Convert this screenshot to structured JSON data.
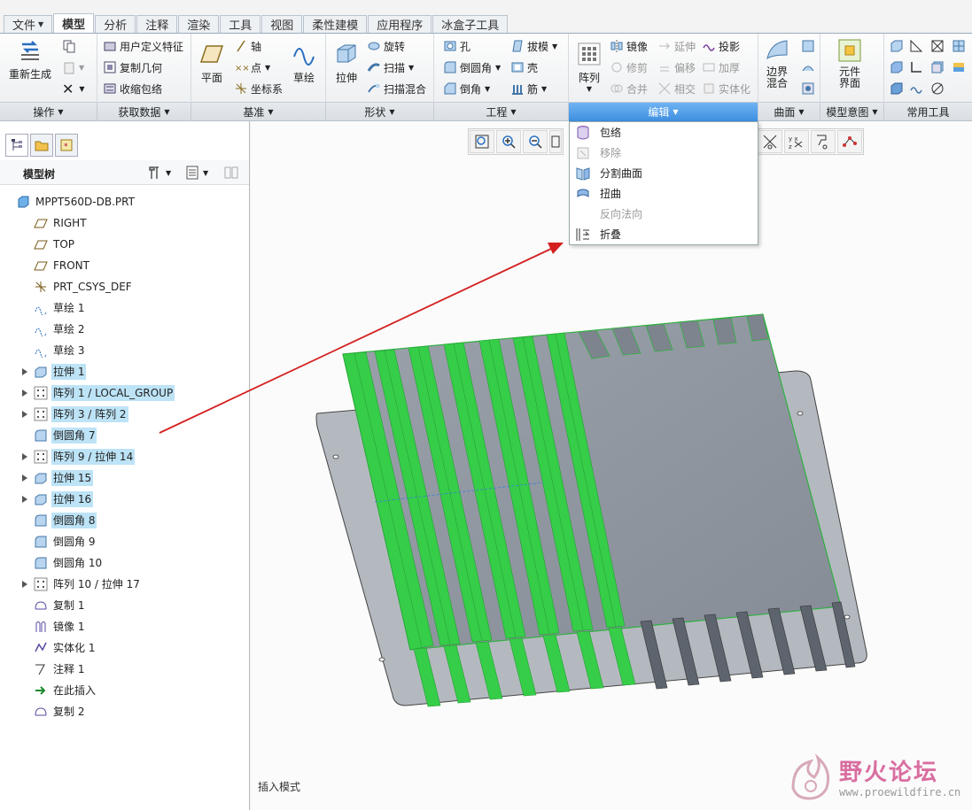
{
  "menubar": {
    "tabs": [
      "文件",
      "模型",
      "分析",
      "注释",
      "渲染",
      "工具",
      "视图",
      "柔性建模",
      "应用程序",
      "冰盒子工具"
    ],
    "active": "模型"
  },
  "ribbon": {
    "regenerate": "重新生成",
    "udf": "用户定义特征",
    "copy_geom": "复制几何",
    "shrinkwrap": "收缩包络",
    "plane": "平面",
    "axis": "轴",
    "point": "点",
    "csys": "坐标系",
    "sketch": "草绘",
    "extrude": "拉伸",
    "revolve": "旋转",
    "sweep": "扫描",
    "swept_blend": "扫描混合",
    "hole": "孔",
    "round": "倒圆角",
    "chamfer": "倒角",
    "draft": "拔模",
    "shell": "壳",
    "rib": "筋",
    "pattern": "阵列",
    "mirror": "镜像",
    "extend": "延伸",
    "project": "投影",
    "trim": "修剪",
    "offset": "偏移",
    "thicken": "加厚",
    "merge": "合并",
    "intersect": "相交",
    "solidify": "实体化",
    "boundary_blend_1": "边界",
    "boundary_blend_2": "混合",
    "component_interface_1": "元件",
    "component_interface_2": "界面"
  },
  "groups": {
    "operations": "操作",
    "get_data": "获取数据",
    "datum": "基准",
    "shapes": "形状",
    "engineering": "工程",
    "editing": "编辑",
    "surfaces": "曲面",
    "model_intent": "模型意图",
    "common_tools": "常用工具"
  },
  "edit_menu": {
    "items": [
      {
        "label": "包络",
        "enabled": true
      },
      {
        "label": "移除",
        "enabled": false
      },
      {
        "label": "分割曲面",
        "enabled": true
      },
      {
        "label": "扭曲",
        "enabled": true
      },
      {
        "label": "反向法向",
        "enabled": false
      },
      {
        "label": "折叠",
        "enabled": true
      }
    ]
  },
  "model_tree": {
    "title": "模型树",
    "items": [
      {
        "label": "MPPT560D-DB.PRT",
        "icon": "part-icon",
        "expandable": false,
        "selected": false,
        "level": 0
      },
      {
        "label": "RIGHT",
        "icon": "datum-plane-icon",
        "expandable": false,
        "selected": false,
        "level": 1
      },
      {
        "label": "TOP",
        "icon": "datum-plane-icon",
        "expandable": false,
        "selected": false,
        "level": 1
      },
      {
        "label": "FRONT",
        "icon": "datum-plane-icon",
        "expandable": false,
        "selected": false,
        "level": 1
      },
      {
        "label": "PRT_CSYS_DEF",
        "icon": "csys-icon",
        "expandable": false,
        "selected": false,
        "level": 1
      },
      {
        "label": "草绘 1",
        "icon": "sketch-icon",
        "expandable": false,
        "selected": false,
        "level": 1
      },
      {
        "label": "草绘 2",
        "icon": "sketch-icon",
        "expandable": false,
        "selected": false,
        "level": 1
      },
      {
        "label": "草绘 3",
        "icon": "sketch-icon",
        "expandable": false,
        "selected": false,
        "level": 1
      },
      {
        "label": "拉伸 1",
        "icon": "extrude-icon",
        "expandable": true,
        "selected": true,
        "level": 1
      },
      {
        "label": "阵列 1 / LOCAL_GROUP",
        "icon": "pattern-icon",
        "expandable": true,
        "selected": true,
        "level": 1
      },
      {
        "label": "阵列 3 / 阵列 2",
        "icon": "pattern-icon",
        "expandable": true,
        "selected": true,
        "level": 1
      },
      {
        "label": "倒圆角 7",
        "icon": "round-icon",
        "expandable": false,
        "selected": true,
        "level": 1
      },
      {
        "label": "阵列 9 / 拉伸 14",
        "icon": "pattern-icon",
        "expandable": true,
        "selected": true,
        "level": 1
      },
      {
        "label": "拉伸 15",
        "icon": "extrude-icon",
        "expandable": true,
        "selected": true,
        "level": 1
      },
      {
        "label": "拉伸 16",
        "icon": "extrude-icon",
        "expandable": true,
        "selected": true,
        "level": 1
      },
      {
        "label": "倒圆角 8",
        "icon": "round-icon",
        "expandable": false,
        "selected": true,
        "level": 1
      },
      {
        "label": "倒圆角 9",
        "icon": "round-icon",
        "expandable": false,
        "selected": false,
        "level": 1
      },
      {
        "label": "倒圆角 10",
        "icon": "round-icon",
        "expandable": false,
        "selected": false,
        "level": 1
      },
      {
        "label": "阵列 10 / 拉伸 17",
        "icon": "pattern-icon",
        "expandable": true,
        "selected": false,
        "level": 1
      },
      {
        "label": "复制 1",
        "icon": "copy-icon",
        "expandable": false,
        "selected": false,
        "level": 1
      },
      {
        "label": "镜像 1",
        "icon": "mirror-icon",
        "expandable": false,
        "selected": false,
        "level": 1
      },
      {
        "label": "实体化 1",
        "icon": "solidify-icon",
        "expandable": false,
        "selected": false,
        "level": 1
      },
      {
        "label": "注释 1",
        "icon": "annotation-icon",
        "expandable": false,
        "selected": false,
        "level": 1
      },
      {
        "label": "在此插入",
        "icon": "insert-here-icon",
        "expandable": false,
        "selected": false,
        "level": 1
      },
      {
        "label": "复制 2",
        "icon": "copy-icon",
        "expandable": false,
        "selected": false,
        "level": 1
      }
    ]
  },
  "status": {
    "mode": "插入模式"
  },
  "watermark": {
    "title": "野火论坛",
    "url": "www.proewildfire.cn"
  },
  "colors": {
    "accent": "#3d8fe0",
    "selection": "#bde3f6",
    "highlight_green": "#33cc44",
    "model_gray": "#8e959f",
    "arrow_red": "#d42020"
  }
}
